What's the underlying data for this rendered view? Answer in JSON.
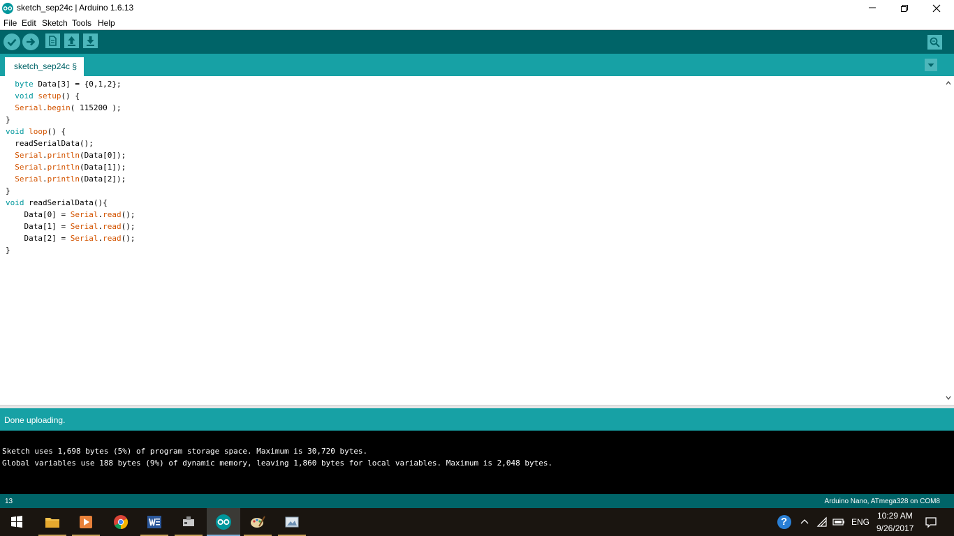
{
  "window": {
    "title": "sketch_sep24c | Arduino 1.6.13"
  },
  "menu": {
    "items": [
      "File",
      "Edit",
      "Sketch",
      "Tools",
      "Help"
    ]
  },
  "toolbar": {
    "buttons": [
      "verify-icon",
      "upload-icon",
      "new-icon",
      "open-icon",
      "save-icon"
    ],
    "serial_monitor_icon": "serial-monitor-icon"
  },
  "tabs": {
    "active_label": "sketch_sep24c §"
  },
  "editor": {
    "lines": [
      "  byte Data[3] = {0,1,2};",
      "  void setup() {",
      "  Serial.begin( 115200 );",
      "}",
      "void loop() {",
      "  readSerialData();",
      "  Serial.println(Data[0]);",
      "  Serial.println(Data[1]);",
      "  Serial.println(Data[2]);",
      "}",
      "void readSerialData(){",
      "    Data[0] = Serial.read();",
      "    Data[1] = Serial.read();",
      "    Data[2] = Serial.read();",
      "}"
    ]
  },
  "status": {
    "message": "Done uploading."
  },
  "console": {
    "lines": [
      "Sketch uses 1,698 bytes (5%) of program storage space. Maximum is 30,720 bytes.",
      "Global variables use 188 bytes (9%) of dynamic memory, leaving 1,860 bytes for local variables. Maximum is 2,048 bytes."
    ]
  },
  "infobar": {
    "line_number": "13",
    "board": "Arduino Nano, ATmega328 on COM8"
  },
  "taskbar": {
    "apps": [
      "start-icon",
      "file-explorer-icon",
      "media-player-icon",
      "chrome-icon",
      "word-icon",
      "usb-drive-icon",
      "arduino-icon",
      "paint-icon",
      "image-viewer-icon"
    ],
    "active_app": "arduino-icon",
    "language": "ENG",
    "time": "10:29 AM",
    "date": "9/26/2017"
  },
  "colors": {
    "arduino_dark": "#006468",
    "arduino_teal": "#17a1a5",
    "keyword_type": "#00979c",
    "keyword_lib": "#d35400"
  }
}
